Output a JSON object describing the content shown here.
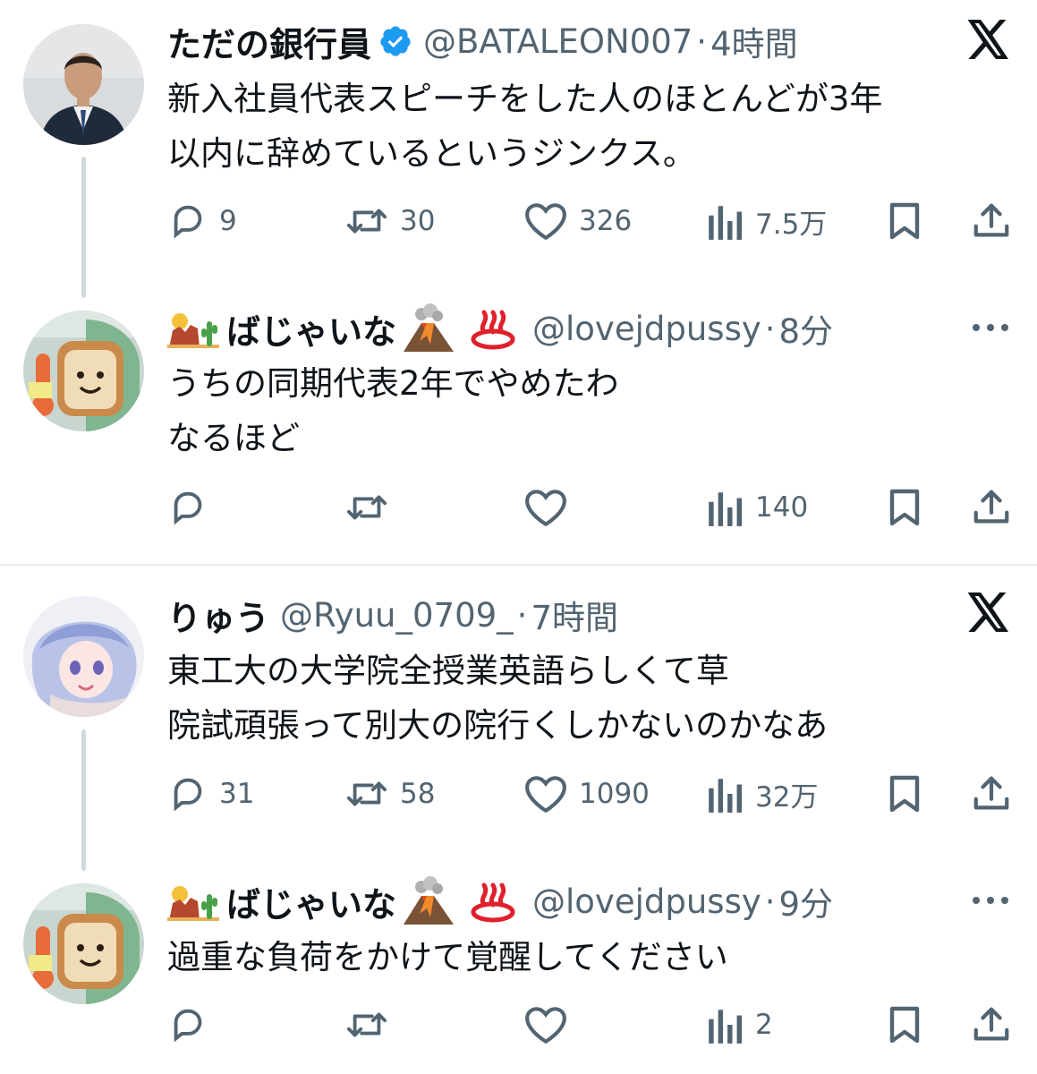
{
  "tweets": [
    {
      "name": "ただの銀行員",
      "handle": "@BATALEON007",
      "time": "4時間",
      "lines": [
        "新入社員代表スピーチをした人のほとんどが3年",
        "以内に辞めているというジンクス。"
      ],
      "replies": "9",
      "retweets": "30",
      "likes": "326",
      "views": "7.5万",
      "verified": true,
      "corner_icon": "x-logo-icon"
    },
    {
      "name": "ばじゃいな",
      "handle": "@lovejdpussy",
      "time": "8分",
      "lines": [
        "うちの同期代表2年でやめたわ",
        "なるほど"
      ],
      "views": "140",
      "corner_icon": "more-icon"
    },
    {
      "name": "りゅう",
      "handle": "@Ryuu_0709_",
      "time": "7時間",
      "lines": [
        "東工大の大学院全授業英語らしくて草",
        "院試頑張って別大の院行くしかないのかなあ"
      ],
      "replies": "31",
      "retweets": "58",
      "likes": "1090",
      "views": "32万",
      "corner_icon": "x-logo-icon"
    },
    {
      "name": "ばじゃいな",
      "handle": "@lovejdpussy",
      "time": "9分",
      "lines": [
        "過重な負荷をかけて覚醒してください"
      ],
      "views": "2",
      "corner_icon": "more-icon"
    }
  ],
  "dot": "·",
  "colors": {
    "text": "#0f1419",
    "secondary": "#536471",
    "verified": "#1d9bf0",
    "thread_line": "#cfd9de"
  }
}
